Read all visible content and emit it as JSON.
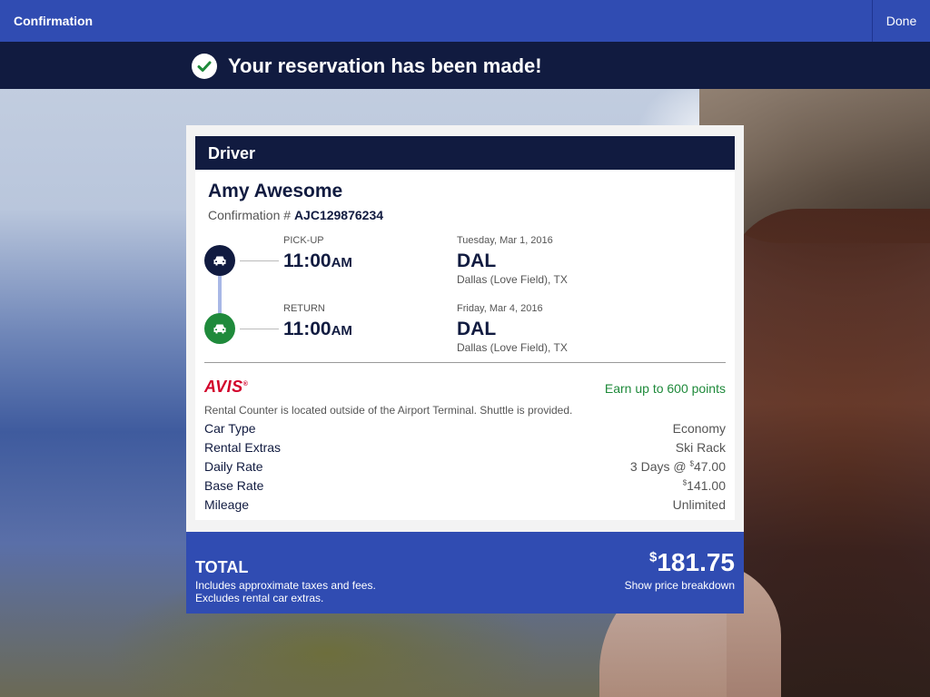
{
  "header": {
    "title": "Confirmation",
    "done_label": "Done"
  },
  "banner": {
    "message": "Your reservation has been made!"
  },
  "driver": {
    "section_title": "Driver",
    "name": "Amy Awesome",
    "confirmation_prefix": "Confirmation #",
    "confirmation_number": "AJC129876234"
  },
  "pickup": {
    "label": "PICK-UP",
    "time": "11:00",
    "ampm": "AM",
    "date": "Tuesday, Mar 1, 2016",
    "airport": "DAL",
    "city": "Dallas (Love Field), TX"
  },
  "return": {
    "label": "RETURN",
    "time": "11:00",
    "ampm": "AM",
    "date": "Friday, Mar 4, 2016",
    "airport": "DAL",
    "city": "Dallas (Love Field), TX"
  },
  "vendor": {
    "logo_text": "AVIS",
    "logo_mark": "®",
    "points": "Earn up to 600 points",
    "note": "Rental Counter is located outside of the Airport Terminal. Shuttle is provided."
  },
  "details": [
    {
      "label": "Car Type",
      "value": "Economy"
    },
    {
      "label": "Rental Extras",
      "value": "Ski Rack"
    },
    {
      "label": "Daily Rate",
      "value_prefix": "3 Days @ ",
      "currency": "$",
      "value": "47.00"
    },
    {
      "label": "Base Rate",
      "currency": "$",
      "value": "141.00"
    },
    {
      "label": "Mileage",
      "value": "Unlimited"
    }
  ],
  "total": {
    "label": "TOTAL",
    "note_line1": "Includes approximate taxes and fees.",
    "note_line2": "Excludes rental car extras.",
    "currency": "$",
    "amount": "181.75",
    "breakdown_link": "Show price breakdown"
  },
  "colors": {
    "primary_blue": "#304cb2",
    "navy": "#111b40",
    "green": "#1f8a3b",
    "avis_red": "#d2002a"
  }
}
